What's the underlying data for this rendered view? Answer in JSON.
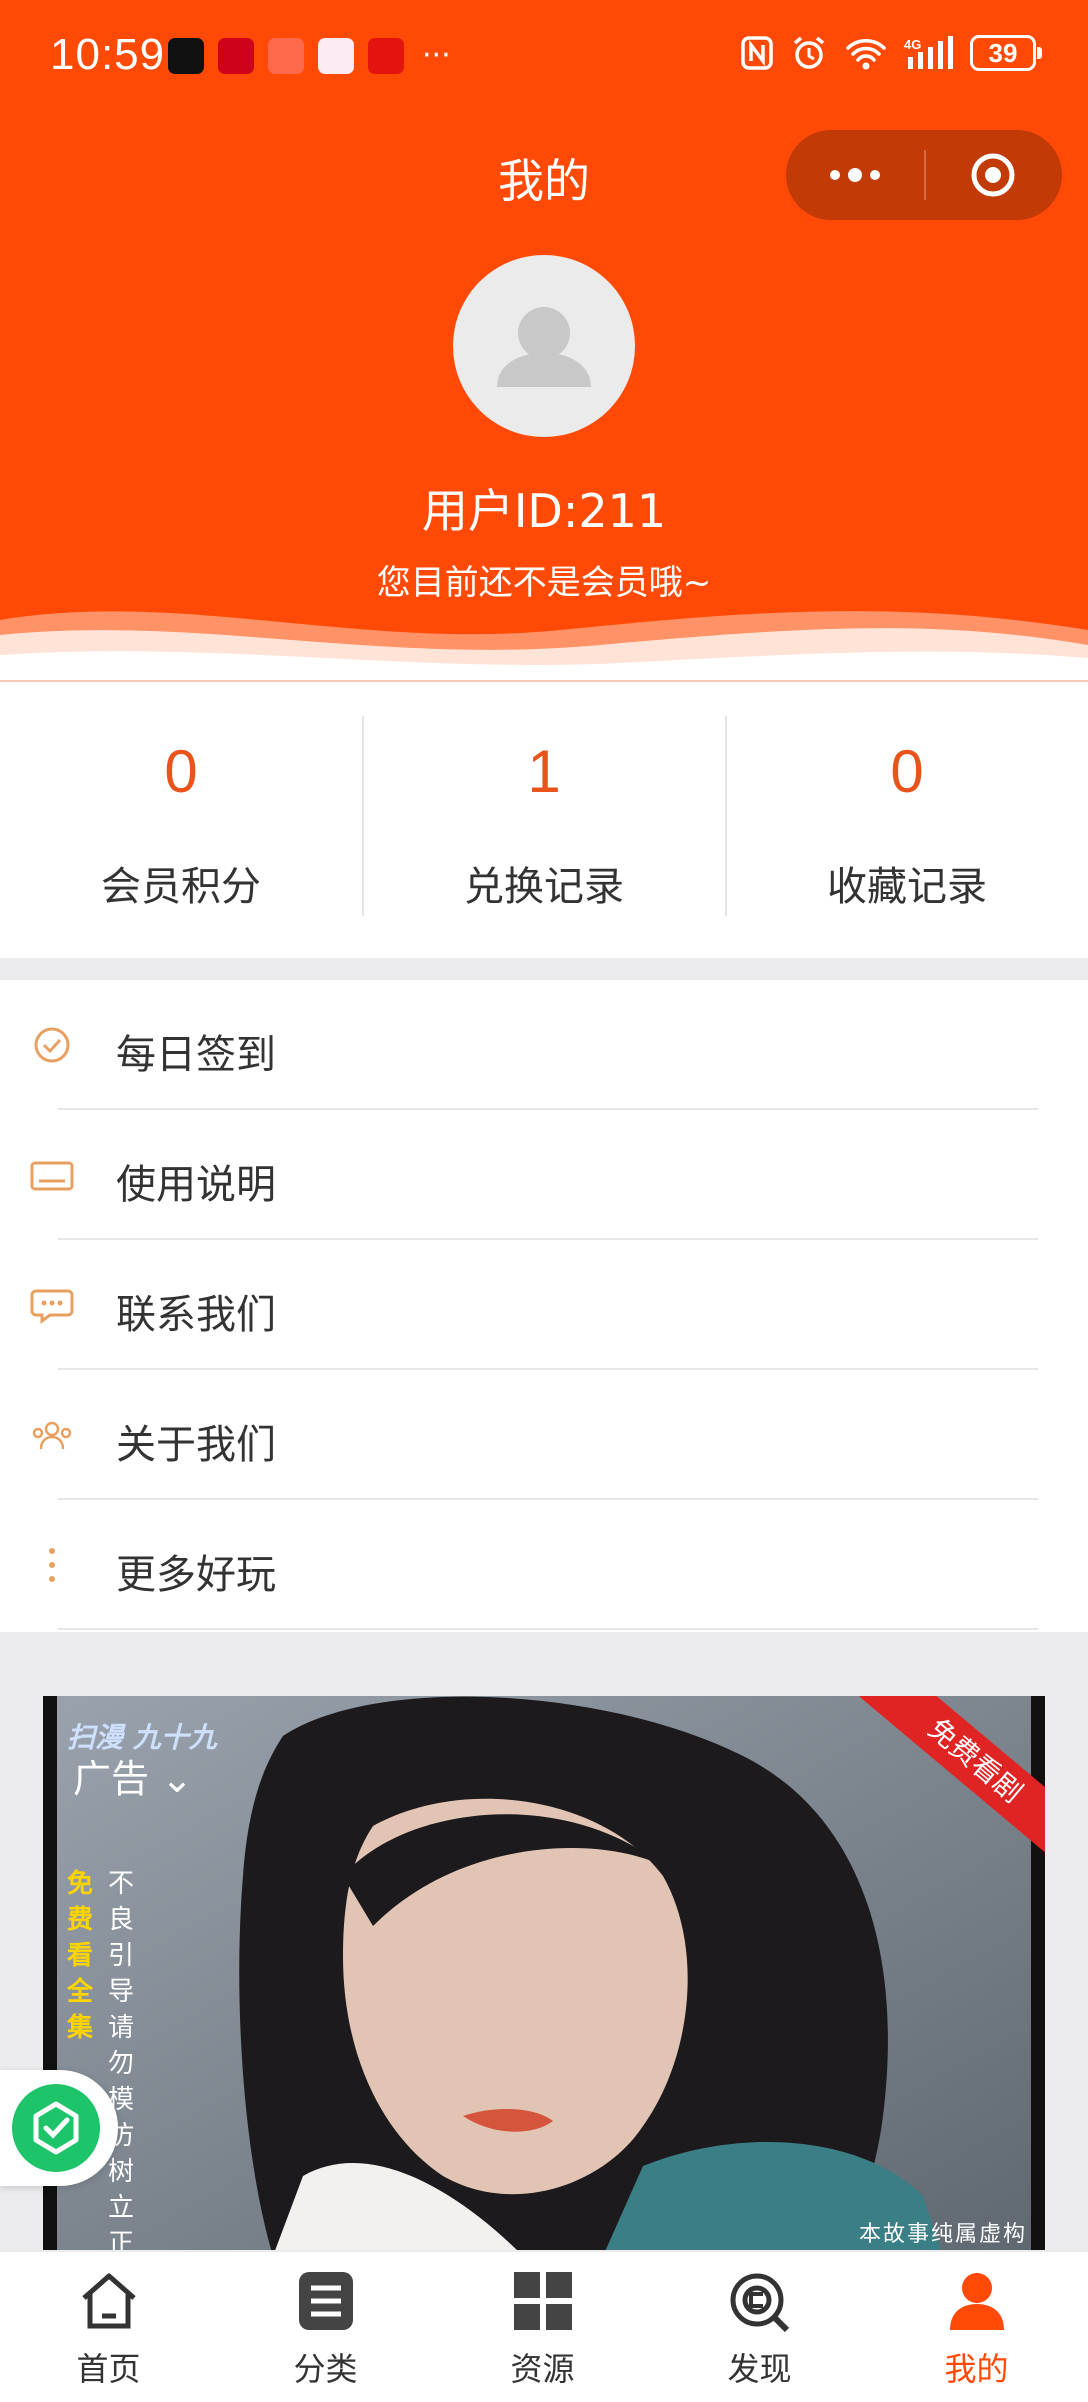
{
  "status_bar": {
    "time": "10:59",
    "battery": "39"
  },
  "header": {
    "title": "我的",
    "user_id": "用户ID:211",
    "member_note": "您目前还不是会员哦~"
  },
  "stats": [
    {
      "value": "0",
      "label": "会员积分"
    },
    {
      "value": "1",
      "label": "兑换记录"
    },
    {
      "value": "0",
      "label": "收藏记录"
    }
  ],
  "menu": [
    {
      "label": "每日签到",
      "icon": "check-circle-icon"
    },
    {
      "label": "使用说明",
      "icon": "card-icon"
    },
    {
      "label": "联系我们",
      "icon": "chat-icon"
    },
    {
      "label": "关于我们",
      "icon": "users-icon"
    },
    {
      "label": "更多好玩",
      "icon": "more-vertical-icon"
    }
  ],
  "ad": {
    "label": "广告",
    "badge": "免费看剧",
    "top_text": "扫漫 九十九",
    "side_text": "不良引导 请勿模仿 树立正确",
    "yellow_text": "免费看全集",
    "footer": "本故事纯属虚构"
  },
  "tabs": [
    {
      "label": "首页",
      "icon": "home-icon"
    },
    {
      "label": "分类",
      "icon": "list-icon"
    },
    {
      "label": "资源",
      "icon": "grid-icon"
    },
    {
      "label": "发现",
      "icon": "discover-icon"
    },
    {
      "label": "我的",
      "icon": "user-icon"
    }
  ],
  "colors": {
    "primary": "#ff4a07",
    "number": "#e8541b",
    "menu_icon": "#e8a060"
  }
}
